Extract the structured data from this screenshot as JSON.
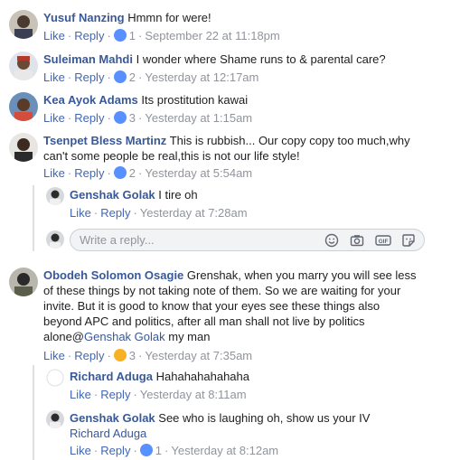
{
  "comments": [
    {
      "author": "Yusuf Nanzing",
      "text": "Hmmn for were!",
      "like_label": "Like",
      "reply_label": "Reply",
      "reaction_count": "1",
      "timestamp": "September 22 at 11:18pm"
    },
    {
      "author": "Suleiman Mahdi",
      "text": "I wonder where Shame runs to & parental care?",
      "like_label": "Like",
      "reply_label": "Reply",
      "reaction_count": "2",
      "timestamp": "Yesterday at 12:17am"
    },
    {
      "author": "Kea Ayok Adams",
      "text": "Its prostitution kawai",
      "like_label": "Like",
      "reply_label": "Reply",
      "reaction_count": "3",
      "timestamp": "Yesterday at 1:15am"
    },
    {
      "author": "Tsenpet Bless Martinz",
      "text_line1": "This is rubbish... Our copy copy too much,why",
      "text_line2": "can't some people be real,this is not our life style!",
      "like_label": "Like",
      "reply_label": "Reply",
      "reaction_count": "2",
      "timestamp": "Yesterday at 5:54am"
    },
    {
      "author": "Genshak Golak",
      "text": "I tire oh",
      "like_label": "Like",
      "reply_label": "Reply",
      "timestamp": "Yesterday at 7:28am"
    },
    {
      "author": "Obodeh Solomon Osagie",
      "text_line1": "Grenshak, when you marry you will see less",
      "text_line2": "of these things by not taking note of them. So we are waiting for your",
      "text_line3": "invite. But it is good to know that your eyes see these things also",
      "text_line4": "beyond APC and politics, after all man shall not live by politics",
      "text_line5_prefix": "alone@",
      "mention": "Genshak Golak",
      "text_line5_suffix": " my man",
      "like_label": "Like",
      "reply_label": "Reply",
      "reaction_count": "3",
      "timestamp": "Yesterday at 7:35am"
    },
    {
      "author": "Richard Aduga",
      "text": "Hahahahahahaha",
      "like_label": "Like",
      "reply_label": "Reply",
      "timestamp": "Yesterday at 8:11am"
    },
    {
      "author": "Genshak Golak",
      "text": "See who is laughing oh, show us your IV",
      "mention": "Richard Aduga",
      "like_label": "Like",
      "reply_label": "Reply",
      "reaction_count": "1",
      "timestamp": "Yesterday at 8:12am"
    }
  ],
  "reply_box": {
    "placeholder": "Write a reply..."
  },
  "colors": {
    "name_blue": "#385898",
    "like_blue": "#5890ff",
    "haha_yellow": "#f7b125",
    "meta_gray": "#90949c"
  }
}
